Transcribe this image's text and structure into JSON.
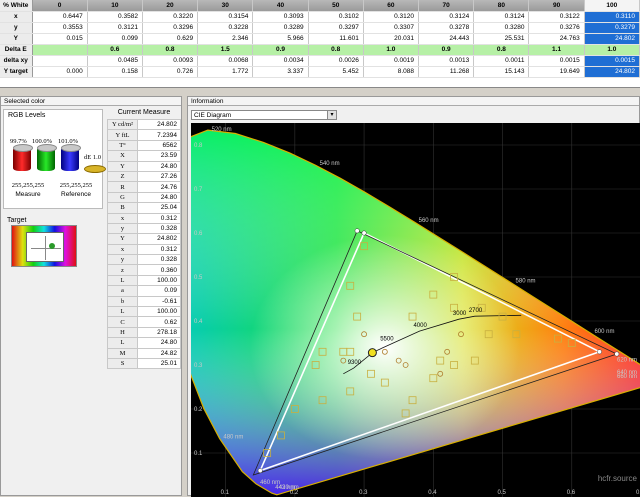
{
  "grid": {
    "corner": "% White",
    "columns": [
      "0",
      "10",
      "20",
      "30",
      "40",
      "50",
      "60",
      "70",
      "80",
      "90",
      "100"
    ],
    "selected_column": 10,
    "rows": [
      {
        "label": "x",
        "values": [
          "0.6447",
          "0.3582",
          "0.3220",
          "0.3154",
          "0.3093",
          "0.3102",
          "0.3120",
          "0.3124",
          "0.3124",
          "0.3122",
          "0.3110"
        ]
      },
      {
        "label": "y",
        "values": [
          "0.3553",
          "0.3121",
          "0.3296",
          "0.3228",
          "0.3289",
          "0.3297",
          "0.3307",
          "0.3278",
          "0.3280",
          "0.3276",
          "0.3279"
        ]
      },
      {
        "label": "Y",
        "values": [
          "0.015",
          "0.099",
          "0.629",
          "2.346",
          "5.966",
          "11.601",
          "20.031",
          "24.443",
          "25.531",
          "24.763",
          "24.802"
        ]
      },
      {
        "label": "Delta E",
        "values": [
          "",
          "0.6",
          "0.8",
          "1.5",
          "0.9",
          "0.8",
          "1.0",
          "0.9",
          "0.8",
          "1.1",
          "1.0"
        ]
      },
      {
        "label": "delta xy",
        "values": [
          "",
          "0.0485",
          "0.0093",
          "0.0068",
          "0.0034",
          "0.0026",
          "0.0019",
          "0.0013",
          "0.0011",
          "0.0015",
          "0.0015"
        ]
      },
      {
        "label": "Y target",
        "values": [
          "0.000",
          "0.158",
          "0.726",
          "1.772",
          "3.337",
          "5.452",
          "8.088",
          "11.268",
          "15.143",
          "19.649",
          "24.802"
        ]
      }
    ]
  },
  "left": {
    "title": "Selected color",
    "rgb_title": "RGB Levels",
    "r_pct": "99.7%",
    "g_pct": "100.0%",
    "b_pct": "101.0%",
    "de": "dE 1.0",
    "measure_rgb": "255,255,255",
    "measure_label": "Measure",
    "reference_rgb": "255,255,255",
    "reference_label": "Reference",
    "target_label": "Target",
    "cm_title": "Current Measure",
    "cm_rows": [
      {
        "k": "Y cd/m²",
        "v": "24.802"
      },
      {
        "k": "Y ftL",
        "v": "7.2394"
      },
      {
        "k": "T°",
        "v": "6562"
      },
      {
        "k": "X",
        "v": "23.59"
      },
      {
        "k": "Y",
        "v": "24.80"
      },
      {
        "k": "Z",
        "v": "27.26"
      },
      {
        "k": "R",
        "v": "24.76"
      },
      {
        "k": "G",
        "v": "24.80"
      },
      {
        "k": "B",
        "v": "25.04"
      },
      {
        "k": "x",
        "v": "0.312"
      },
      {
        "k": "y",
        "v": "0.328"
      },
      {
        "k": "Y",
        "v": "24.802"
      },
      {
        "k": "x",
        "v": "0.312"
      },
      {
        "k": "y",
        "v": "0.328"
      },
      {
        "k": "z",
        "v": "0.360"
      },
      {
        "k": "L",
        "v": "100.00"
      },
      {
        "k": "a",
        "v": "0.09"
      },
      {
        "k": "b",
        "v": "-0.61"
      },
      {
        "k": "L",
        "v": "100.00"
      },
      {
        "k": "C",
        "v": "0.62"
      },
      {
        "k": "H",
        "v": "278.18"
      },
      {
        "k": "L",
        "v": "24.80"
      },
      {
        "k": "M",
        "v": "24.82"
      },
      {
        "k": "S",
        "v": "25.01"
      }
    ]
  },
  "right": {
    "title": "Information",
    "diagram_select": "CIE Diagram",
    "watermark": "hcfr.source"
  },
  "chart_data": {
    "type": "scatter",
    "xlim": [
      0.05,
      0.7
    ],
    "ylim": [
      0.0,
      0.85
    ],
    "x_ticks": [
      "0.1",
      "0.2",
      "0.3",
      "0.4",
      "0.5",
      "0.6",
      "0.7"
    ],
    "y_ticks": [
      "0.1",
      "0.2",
      "0.3",
      "0.4",
      "0.5",
      "0.6",
      "0.7",
      "0.8"
    ],
    "wavelength_labels": [
      {
        "label": "520 nm",
        "x": 0.074,
        "y": 0.834
      },
      {
        "label": "540 nm",
        "x": 0.23,
        "y": 0.754
      },
      {
        "label": "560 nm",
        "x": 0.373,
        "y": 0.625
      },
      {
        "label": "580 nm",
        "x": 0.513,
        "y": 0.487
      },
      {
        "label": "600 nm",
        "x": 0.627,
        "y": 0.373
      },
      {
        "label": "620 nm",
        "x": 0.691,
        "y": 0.308
      },
      {
        "label": "640 nm",
        "x": 0.72,
        "y": 0.279
      },
      {
        "label": "660 nm",
        "x": 0.73,
        "y": 0.27
      },
      {
        "label": "500 nm",
        "x": 0.008,
        "y": 0.538
      },
      {
        "label": "480 nm",
        "x": 0.091,
        "y": 0.133
      },
      {
        "label": "460 nm",
        "x": 0.144,
        "y": 0.03
      },
      {
        "label": "443 nm",
        "x": 0.166,
        "y": 0.009
      },
      {
        "label": "420 nm",
        "x": 0.171,
        "y": 0.005
      }
    ],
    "cct_labels": [
      {
        "label": "2700",
        "x": 0.46,
        "y": 0.411
      },
      {
        "label": "3000",
        "x": 0.437,
        "y": 0.404
      },
      {
        "label": "4000",
        "x": 0.38,
        "y": 0.377
      },
      {
        "label": "5500",
        "x": 0.332,
        "y": 0.347
      },
      {
        "label": "9300",
        "x": 0.285,
        "y": 0.293
      }
    ],
    "gamut_target": [
      [
        0.64,
        0.33
      ],
      [
        0.3,
        0.6
      ],
      [
        0.15,
        0.06
      ]
    ],
    "gamut_measured": [
      [
        0.665,
        0.325
      ],
      [
        0.29,
        0.605
      ],
      [
        0.14,
        0.05
      ]
    ],
    "measured_white": [
      0.312,
      0.328
    ]
  }
}
